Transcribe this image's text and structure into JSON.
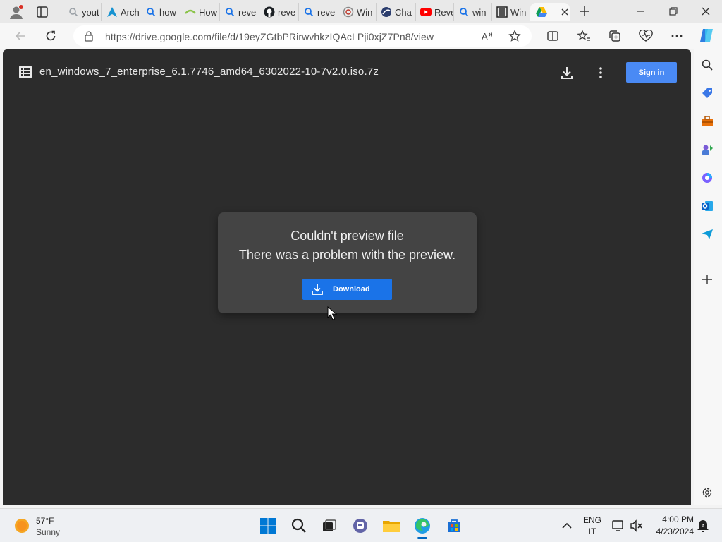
{
  "tabs": [
    {
      "label": "yout",
      "icon": "search-icon"
    },
    {
      "label": "Arch",
      "icon": "arch-logo-icon"
    },
    {
      "label": "how",
      "icon": "search-icon"
    },
    {
      "label": "How",
      "icon": "page-icon"
    },
    {
      "label": "reve",
      "icon": "search-icon"
    },
    {
      "label": "reve",
      "icon": "github-icon"
    },
    {
      "label": "reve",
      "icon": "search-icon"
    },
    {
      "label": "Win",
      "icon": "page-icon"
    },
    {
      "label": "Cha",
      "icon": "page-icon"
    },
    {
      "label": "Reve",
      "icon": "youtube-icon"
    },
    {
      "label": "win",
      "icon": "search-icon"
    },
    {
      "label": "Win",
      "icon": "archive-icon"
    },
    {
      "label": "",
      "icon": "google-drive-icon",
      "active": true
    }
  ],
  "address_bar": {
    "url": "https://drive.google.com/file/d/19eyZGtbPRirwvhkzIQAcLPji0xjZ7Pn8/view"
  },
  "viewer": {
    "file_name": "en_windows_7_enterprise_6.1.7746_amd64_6302022-10-7v2.0.iso.7z",
    "sign_in_label": "Sign in",
    "dialog": {
      "title": "Couldn't preview file",
      "message": "There was a problem with the preview.",
      "download_label": "Download"
    }
  },
  "taskbar": {
    "weather_temp": "57°F",
    "weather_desc": "Sunny",
    "lang_primary": "ENG",
    "lang_secondary": "IT",
    "time": "4:00 PM",
    "date": "4/23/2024"
  },
  "colors": {
    "viewer_bg": "#2c2c2c",
    "dialog_bg": "#444444",
    "download_button": "#1a73e8",
    "sign_in_button": "#4a8af4"
  }
}
